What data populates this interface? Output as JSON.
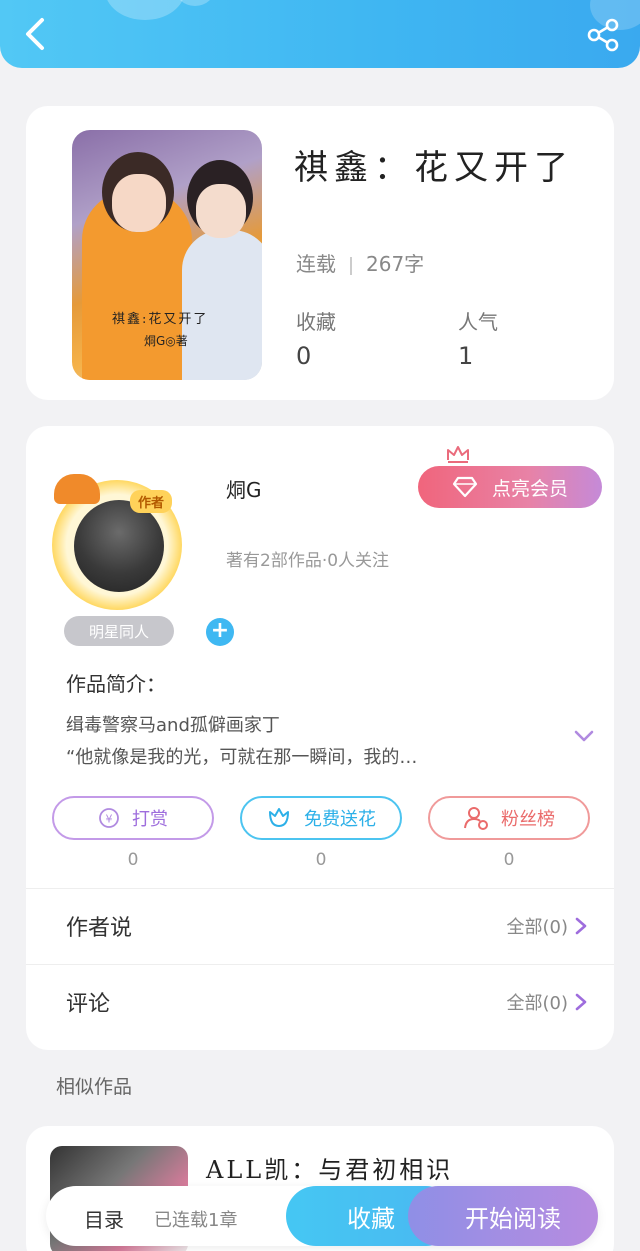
{
  "header": {
    "back_icon": "chevron-left-icon",
    "share_icon": "share-icon"
  },
  "book": {
    "title": "祺鑫：花又开了",
    "cover_title": "祺鑫:花又开了",
    "cover_author": "烔G◎著",
    "status": "连载",
    "word_count": "267字",
    "collect_label": "收藏",
    "collect_value": "0",
    "popularity_label": "人气",
    "popularity_value": "1"
  },
  "author": {
    "name": "烔G",
    "avatar_badge": "作者",
    "vip_label": "点亮会员",
    "stats": "著有2部作品·0人关注",
    "tag": "明星同人",
    "add_tag": "+",
    "intro_title": "作品简介：",
    "intro_lines": [
      "缉毒警察马and孤僻画家丁",
      "“他就像是我的光，可就在那一瞬间，我的…"
    ]
  },
  "actions": [
    {
      "label": "打赏",
      "count": "0"
    },
    {
      "label": "免费送花",
      "count": "0"
    },
    {
      "label": "粉丝榜",
      "count": "0"
    }
  ],
  "rows": [
    {
      "label": "作者说",
      "right": "全部(0)"
    },
    {
      "label": "评论",
      "right": "全部(0)"
    }
  ],
  "similar": {
    "section_title": "相似作品",
    "book_title": "ALL凯：与君初相识"
  },
  "bottom_bar": {
    "toc": "目录",
    "chapters": "已连载1章",
    "collect": "收藏",
    "read": "开始阅读"
  },
  "colors": {
    "header": "#3fb6f2",
    "vip_gradient_start": "#f0657c",
    "vip_gradient_end": "#c58ad8",
    "reward": "#9e6ddd",
    "flower": "#2cb0e8",
    "fans": "#ea6b6b"
  }
}
